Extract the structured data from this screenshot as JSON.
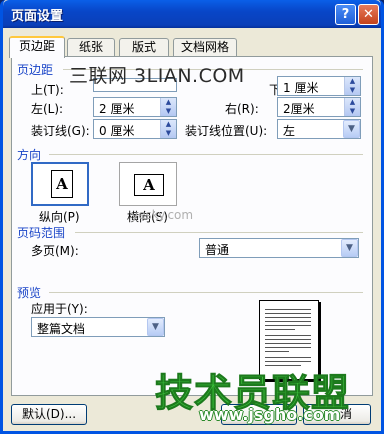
{
  "window": {
    "title": "页面设置"
  },
  "titlebar": {
    "help": "?",
    "close": "✕"
  },
  "tabs": [
    "页边距",
    "纸张",
    "版式",
    "文档网格"
  ],
  "margins": {
    "section": "页边距",
    "top_label": "上(T):",
    "bottom_label": "下",
    "bottom_value": "1 厘米",
    "left_label": "左(L):",
    "left_value": "2 厘米",
    "right_label": "右(R):",
    "right_value": "2厘米",
    "gutter_label": "装订线(G):",
    "gutter_value": "0 厘米",
    "gutter_pos_label": "装订线位置(U):",
    "gutter_pos_value": "左"
  },
  "orientation": {
    "section": "方向",
    "portrait_glyph": "A",
    "landscape_glyph": "A",
    "portrait_label": "纵向(P)",
    "landscape_label": "横向(S)"
  },
  "pages": {
    "section": "页码范围",
    "multiple_label": "多页(M):",
    "multiple_value": "普通"
  },
  "preview": {
    "section": "预览",
    "apply_label": "应用于(Y):",
    "apply_value": "整篇文档"
  },
  "buttons": {
    "default": "默认(D)...",
    "cancel": "消"
  },
  "watermarks": {
    "top": "三联网 3LIAN.COM",
    "middle": "yesky.com",
    "logo": "技术员联盟",
    "site": "www.jsgho.com"
  },
  "colors": {
    "titlebar": "#0846c8",
    "section_text": "#1b46c8",
    "dialog_bg": "#ece9d8"
  }
}
